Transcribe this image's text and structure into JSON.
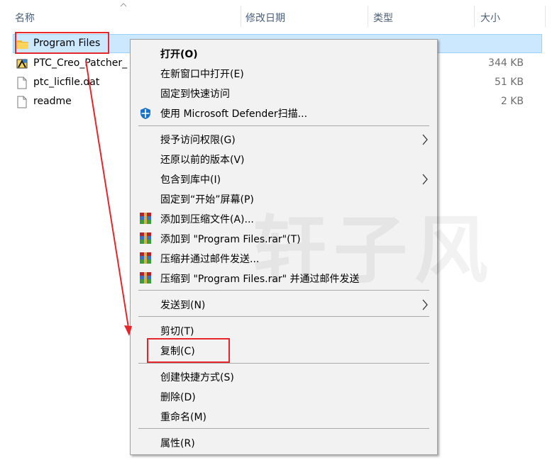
{
  "columns": {
    "name": "名称",
    "date": "修改日期",
    "type": "类型",
    "size": "大小"
  },
  "files": [
    {
      "name": "Program Files",
      "size": "",
      "icon": "folder-icon",
      "selected": true
    },
    {
      "name": "PTC_Creo_Patcher_",
      "size": "344 KB",
      "icon": "patcher-exe-icon"
    },
    {
      "name": "ptc_licfile.dat",
      "size": "51 KB",
      "icon": "file-icon"
    },
    {
      "name": "readme",
      "size": "2 KB",
      "icon": "file-icon"
    }
  ],
  "context_menu": {
    "items": [
      {
        "label": "打开(O)",
        "bold": true
      },
      {
        "label": "在新窗口中打开(E)"
      },
      {
        "label": "固定到快速访问"
      },
      {
        "label": "使用 Microsoft Defender扫描...",
        "icon": "defender-shield-icon"
      },
      {
        "label": "授予访问权限(G)",
        "submenu": true
      },
      {
        "label": "还原以前的版本(V)"
      },
      {
        "label": "包含到库中(I)",
        "submenu": true
      },
      {
        "label": "固定到“开始”屏幕(P)"
      },
      {
        "label": "添加到压缩文件(A)...",
        "icon": "winrar-icon"
      },
      {
        "label": "添加到 \"Program Files.rar\"(T)",
        "icon": "winrar-icon"
      },
      {
        "label": "压缩并通过邮件发送...",
        "icon": "winrar-icon"
      },
      {
        "label": "压缩到 \"Program Files.rar\" 并通过邮件发送",
        "icon": "winrar-icon"
      },
      {
        "label": "发送到(N)",
        "submenu": true
      },
      {
        "label": "剪切(T)"
      },
      {
        "label": "复制(C)",
        "highlighted_by_annotation": true
      },
      {
        "label": "创建快捷方式(S)"
      },
      {
        "label": "删除(D)"
      },
      {
        "label": "重命名(M)"
      },
      {
        "label": "属性(R)"
      }
    ]
  },
  "watermark": "轩子风",
  "colors": {
    "selection": "#cce8ff",
    "annotation": "#e5262a",
    "header_text": "#4c607a",
    "menu_bg": "#f2f2f2"
  }
}
